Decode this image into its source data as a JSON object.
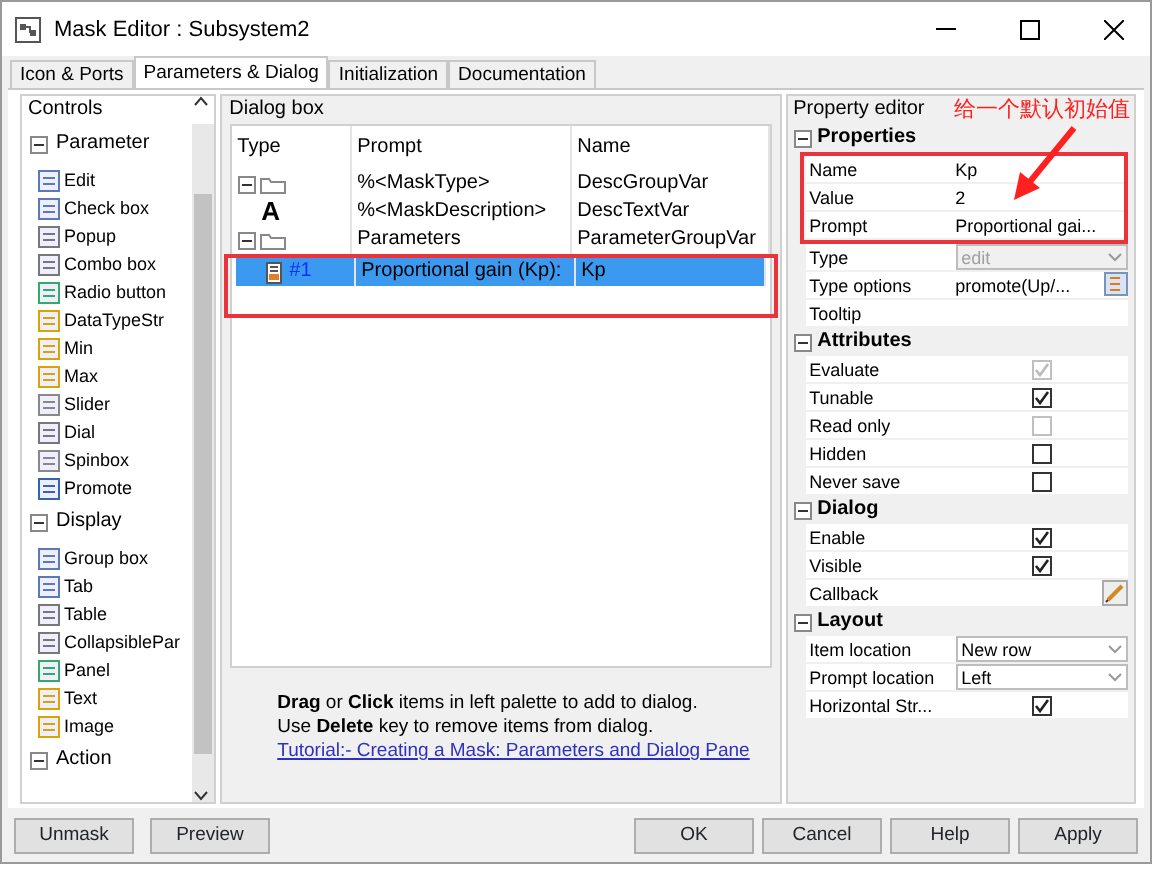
{
  "window": {
    "title": "Mask Editor : Subsystem2"
  },
  "tabs": [
    {
      "label": "Icon & Ports",
      "selected": false
    },
    {
      "label": "Parameters & Dialog",
      "selected": true
    },
    {
      "label": "Initialization",
      "selected": false
    },
    {
      "label": "Documentation",
      "selected": false
    }
  ],
  "controls": {
    "title": "Controls",
    "groups": [
      {
        "label": "Parameter",
        "expanded": true,
        "items": [
          "Edit",
          "Check box",
          "Popup",
          "Combo box",
          "Radio button",
          "DataTypeStr",
          "Min",
          "Max",
          "Slider",
          "Dial",
          "Spinbox",
          "Promote"
        ]
      },
      {
        "label": "Display",
        "expanded": true,
        "items": [
          "Group box",
          "Tab",
          "Table",
          "CollapsiblePar",
          "Panel",
          "Text",
          "Image"
        ]
      },
      {
        "label": "Action",
        "expanded": true
      }
    ]
  },
  "dialog_box": {
    "title": "Dialog box",
    "columns": [
      "Type",
      "Prompt",
      "Name"
    ],
    "rows": [
      {
        "type": "",
        "prompt": "%<MaskType>",
        "name": "DescGroupVar",
        "selected": false,
        "children": [
          {
            "type": "A",
            "prompt": "%<MaskDescription>",
            "name": "DescTextVar",
            "selected": false
          }
        ]
      },
      {
        "type": "",
        "prompt": "Parameters",
        "name": "ParameterGroupVar",
        "selected": false,
        "children": [
          {
            "type": "#1",
            "prompt": "Proportional gain (Kp):",
            "name": "Kp",
            "selected": true,
            "highlighted": true
          }
        ]
      }
    ],
    "help": [
      "**Drag** or **Click** items in left palette to add to dialog.",
      "Use **Delete** key to remove items from dialog."
    ],
    "link": "Tutorial:- Creating a Mask: Parameters and Dialog Pane"
  },
  "property_editor": {
    "title": "Property editor",
    "sections": [
      {
        "label": "Properties",
        "expanded": true,
        "rows": [
          {
            "label": "Name",
            "kind": "text",
            "value": "Kp",
            "highlighted": true
          },
          {
            "label": "Value",
            "kind": "text",
            "value": "2",
            "highlighted": true
          },
          {
            "label": "Prompt",
            "kind": "text",
            "value": "Proportional gai...",
            "highlighted": true
          },
          {
            "label": "Type",
            "kind": "dropdown",
            "value": "edit",
            "disabled": true
          },
          {
            "label": "Type options",
            "kind": "button",
            "value": "promote(Up/..."
          },
          {
            "label": "Tooltip",
            "kind": "text"
          }
        ]
      },
      {
        "label": "Attributes",
        "expanded": true,
        "rows": [
          {
            "label": "Evaluate",
            "kind": "checkbox",
            "checked": true,
            "disabled": true,
            "highlighted": false
          },
          {
            "label": "Tunable",
            "kind": "checkbox",
            "checked": true,
            "disabled": false,
            "highlighted": false
          },
          {
            "label": "Read only",
            "kind": "checkbox",
            "checked": false,
            "disabled": true,
            "highlighted": false
          },
          {
            "label": "Hidden",
            "kind": "checkbox",
            "checked": false,
            "disabled": false,
            "highlighted": false
          },
          {
            "label": "Never save",
            "kind": "checkbox",
            "checked": false,
            "disabled": false,
            "highlighted": false
          }
        ]
      },
      {
        "label": "Dialog",
        "expanded": true,
        "rows": [
          {
            "label": "Enable",
            "kind": "checkbox",
            "checked": true,
            "disabled": false,
            "highlighted": false
          },
          {
            "label": "Visible",
            "kind": "checkbox",
            "checked": true,
            "disabled": false,
            "highlighted": false
          },
          {
            "label": "Callback",
            "kind": "edit",
            "highlighted": false
          }
        ]
      },
      {
        "label": "Layout",
        "expanded": true,
        "rows": [
          {
            "label": "Item location",
            "kind": "dropdown",
            "value": "New row",
            "disabled": false
          },
          {
            "label": "Prompt location",
            "kind": "dropdown",
            "value": "Left",
            "disabled": false
          },
          {
            "label": "Horizontal Str...",
            "kind": "checkbox",
            "checked": true,
            "disabled": false,
            "highlighted": false
          }
        ]
      }
    ]
  },
  "annotation": {
    "text": "给一个默认初始值"
  },
  "buttons_left": [
    "Unmask",
    "Preview"
  ],
  "buttons_right": [
    "OK",
    "Cancel",
    "Help",
    "Apply"
  ]
}
